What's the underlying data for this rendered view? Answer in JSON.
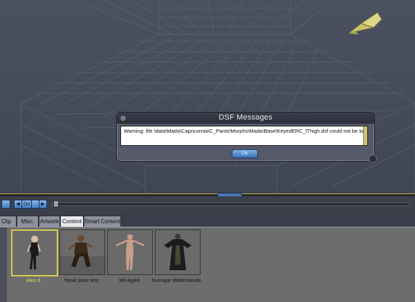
{
  "dialog": {
    "title": "DSF Messages",
    "message": "Warning: file \\data\\Mada\\Capricornia\\C_Pants\\Morphs\\Mada\\Base\\KeyedERC_lThigh.dsf could not be loaded",
    "ok_label": "OK"
  },
  "timeline": {
    "buttons": [
      "◀",
      "On",
      "▶"
    ]
  },
  "library": {
    "tabs": [
      {
        "label": "Clip",
        "active": false
      },
      {
        "label": "Misc.",
        "active": false
      },
      {
        "label": "Artwork",
        "active": false
      },
      {
        "label": "Content",
        "active": true
      },
      {
        "label": "Smart Content",
        "active": false
      }
    ],
    "items": [
      {
        "label": "Aiko 6",
        "selected": true
      },
      {
        "label": "freak pose test",
        "selected": false
      },
      {
        "label": "M4 Aged",
        "selected": false
      },
      {
        "label": "Svengar Wildenlande.",
        "selected": false
      }
    ]
  },
  "colors": {
    "accent": "#c5b23a",
    "ok_button": "#3c74b8",
    "selected_label": "#e5d951"
  }
}
